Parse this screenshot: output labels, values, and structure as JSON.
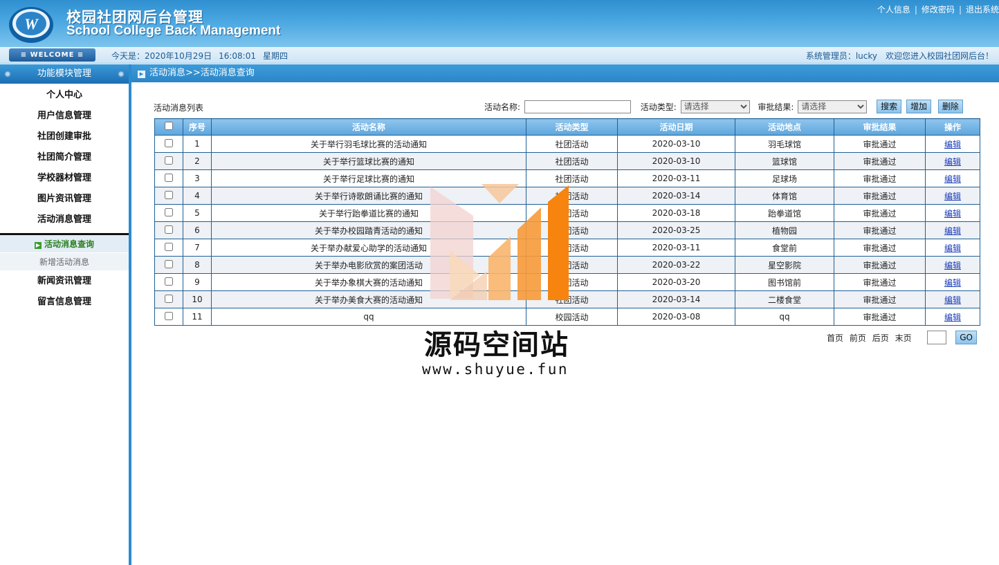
{
  "header": {
    "title_cn": "校园社团网后台管理",
    "title_en": "School College Back Management",
    "links": [
      "个人信息",
      "修改密码",
      "退出系统"
    ]
  },
  "welcome": {
    "badge": "≡ WELCOME ≡",
    "date_label": "今天是：2020年10月29日",
    "time": "16:08:01",
    "weekday": "星期四",
    "admin": "系统管理员：lucky",
    "greeting": "欢迎您进入校园社团网后台！"
  },
  "sidebar": {
    "heading": "功能模块管理",
    "items_top": [
      "个人中心",
      "用户信息管理",
      "社团创建审批",
      "社团简介管理",
      "学校器材管理",
      "图片资讯管理",
      "活动消息管理"
    ],
    "submenu": [
      "活动消息查询",
      "新增活动消息"
    ],
    "items_bottom": [
      "新闻资讯管理",
      "留言信息管理"
    ]
  },
  "breadcrumb": "活动消息>>活动消息查询",
  "list_title": "活动消息列表",
  "filters": {
    "name_label": "活动名称:",
    "type_label": "活动类型:",
    "type_value": "请选择",
    "result_label": "审批结果:",
    "result_value": "请选择",
    "search": "搜索",
    "add": "增加",
    "delete": "删除"
  },
  "table": {
    "headers": [
      "序号",
      "活动名称",
      "活动类型",
      "活动日期",
      "活动地点",
      "审批结果",
      "操作"
    ],
    "rows": [
      {
        "no": "1",
        "name": "关于举行羽毛球比赛的活动通知",
        "type": "社团活动",
        "date": "2020-03-10",
        "place": "羽毛球馆",
        "result": "审批通过",
        "op": "编辑"
      },
      {
        "no": "2",
        "name": "关于举行篮球比赛的通知",
        "type": "社团活动",
        "date": "2020-03-10",
        "place": "篮球馆",
        "result": "审批通过",
        "op": "编辑"
      },
      {
        "no": "3",
        "name": "关于举行足球比赛的通知",
        "type": "社团活动",
        "date": "2020-03-11",
        "place": "足球场",
        "result": "审批通过",
        "op": "编辑"
      },
      {
        "no": "4",
        "name": "关于举行诗歌朗诵比赛的通知",
        "type": "社团活动",
        "date": "2020-03-14",
        "place": "体育馆",
        "result": "审批通过",
        "op": "编辑"
      },
      {
        "no": "5",
        "name": "关于举行跆拳道比赛的通知",
        "type": "社团活动",
        "date": "2020-03-18",
        "place": "跆拳道馆",
        "result": "审批通过",
        "op": "编辑"
      },
      {
        "no": "6",
        "name": "关于举办校园踏青活动的通知",
        "type": "社团活动",
        "date": "2020-03-25",
        "place": "植物园",
        "result": "审批通过",
        "op": "编辑"
      },
      {
        "no": "7",
        "name": "关于举办献爱心助学的活动通知",
        "type": "社团活动",
        "date": "2020-03-11",
        "place": "食堂前",
        "result": "审批通过",
        "op": "编辑"
      },
      {
        "no": "8",
        "name": "关于举办电影欣赏的案团活动",
        "type": "社团活动",
        "date": "2020-03-22",
        "place": "星空影院",
        "result": "审批通过",
        "op": "编辑"
      },
      {
        "no": "9",
        "name": "关于举办象棋大赛的活动通知",
        "type": "社团活动",
        "date": "2020-03-20",
        "place": "图书馆前",
        "result": "审批通过",
        "op": "编辑"
      },
      {
        "no": "10",
        "name": "关于举办美食大赛的活动通知",
        "type": "社团活动",
        "date": "2020-03-14",
        "place": "二楼食堂",
        "result": "审批通过",
        "op": "编辑"
      },
      {
        "no": "11",
        "name": "qq",
        "type": "校园活动",
        "date": "2020-03-08",
        "place": "qq",
        "result": "审批通过",
        "op": "编辑"
      }
    ]
  },
  "pager": {
    "first": "首页",
    "prev": "前页",
    "next": "后页",
    "last": "末页",
    "go": "GO"
  },
  "watermark": {
    "title": "源码空间站",
    "url": "www.shuyue.fun"
  }
}
